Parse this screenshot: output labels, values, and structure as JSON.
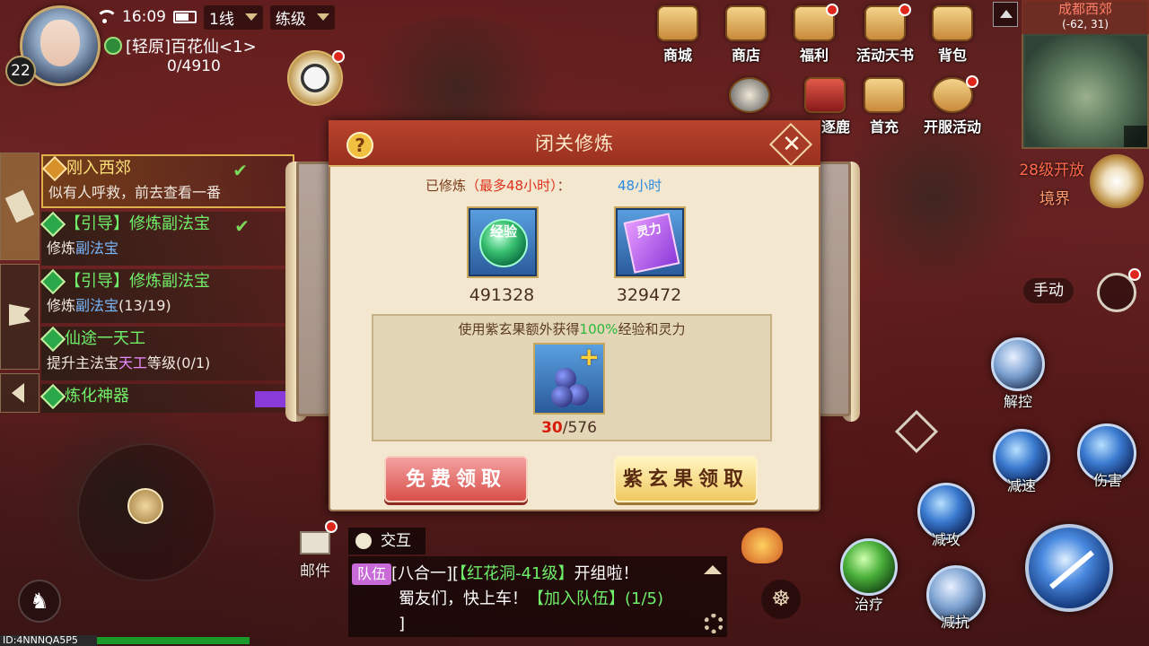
{
  "status": {
    "time": "16:09",
    "line": "1线",
    "mode": "练级"
  },
  "player": {
    "level": "22",
    "name": "[轻原]百花仙<1>",
    "exp": "0/4910"
  },
  "top_menu": [
    {
      "label": "商城",
      "icon": "shop-mall-icon"
    },
    {
      "label": "商店",
      "icon": "store-icon"
    },
    {
      "label": "福利",
      "icon": "welfare-icon"
    },
    {
      "label": "活动天书",
      "icon": "event-book-icon"
    },
    {
      "label": "背包",
      "icon": "bag-icon"
    }
  ],
  "second_menu": [
    {
      "label": "逐鹿",
      "icon": "battle-icon"
    },
    {
      "label": "首充",
      "icon": "first-recharge-icon"
    },
    {
      "label": "开服活动",
      "icon": "server-event-icon"
    }
  ],
  "map": {
    "name": "成都西郊",
    "coords": "(-62, 31)"
  },
  "realm": {
    "line1": "28级开放",
    "line2": "境界"
  },
  "quests": [
    {
      "title": "刚入西郊",
      "desc": "似有人呼救，前去查看一番",
      "done": true,
      "type": "main"
    },
    {
      "title": "【引导】修炼副法宝",
      "desc_pre": "修炼",
      "desc_hl": "副法宝",
      "desc_post": "",
      "done": true,
      "type": "side"
    },
    {
      "title": "【引导】修炼副法宝",
      "desc_pre": "修炼",
      "desc_hl": "副法宝",
      "desc_post": "(13/19)",
      "done": false,
      "type": "side"
    },
    {
      "title": "仙途一天工",
      "desc_pre": "提升主法宝",
      "desc_hl": "天工",
      "desc_post": "等级(0/1)",
      "done": false,
      "type": "side"
    },
    {
      "title": "炼化神器",
      "done": false,
      "type": "side"
    }
  ],
  "modal": {
    "title": "闭关修炼",
    "trained_prefix": "已修炼",
    "trained_limit": "（最多48小时）",
    "trained_colon": "：",
    "trained_value": "48小时",
    "exp_icon_text": "经验",
    "spirit_icon_text": "灵力",
    "exp_value": "491328",
    "spirit_value": "329472",
    "fruit_text_pre": "使用紫玄果额外获得",
    "fruit_text_pct": "100%",
    "fruit_text_post": "经验和灵力",
    "fruit_count_current": "30",
    "fruit_count_total": "/576",
    "free_button": "免费领取",
    "fruit_button": "紫玄果领取"
  },
  "mail": {
    "label": "邮件"
  },
  "chat": {
    "tab": "交互",
    "tag": "队伍",
    "line1_pre": "[八合一][",
    "line1_green": "【红花洞-41级】",
    "line1_post": "开组啦！",
    "line2_pre": "蜀友们，快上车！",
    "line2_green": "【加入队伍】(1/5)",
    "line3": "]"
  },
  "controls": {
    "manual": "手动"
  },
  "skills": {
    "jiekong": "解控",
    "jiansu": "减速",
    "shanghai": "伤害",
    "jiangong": "减攻",
    "zhiliao": "治疗",
    "jiankang": "减抗"
  },
  "footer": {
    "id": "ID:4NNNQA5P5"
  }
}
